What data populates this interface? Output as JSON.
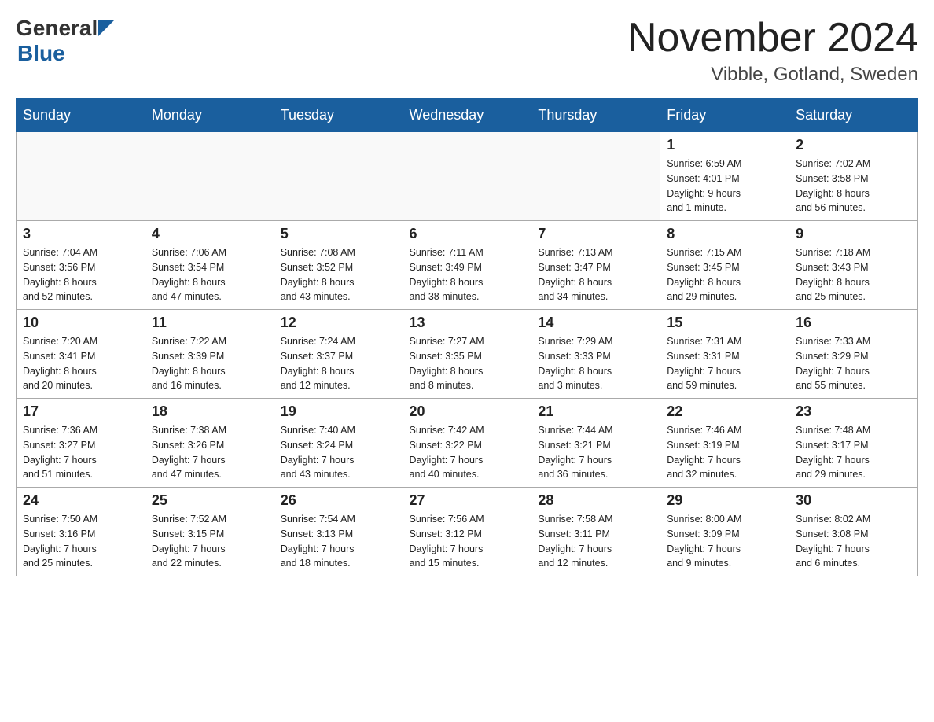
{
  "header": {
    "logo_general": "General",
    "logo_blue": "Blue",
    "month_year": "November 2024",
    "location": "Vibble, Gotland, Sweden"
  },
  "days_of_week": [
    "Sunday",
    "Monday",
    "Tuesday",
    "Wednesday",
    "Thursday",
    "Friday",
    "Saturday"
  ],
  "weeks": [
    [
      {
        "day": "",
        "info": ""
      },
      {
        "day": "",
        "info": ""
      },
      {
        "day": "",
        "info": ""
      },
      {
        "day": "",
        "info": ""
      },
      {
        "day": "",
        "info": ""
      },
      {
        "day": "1",
        "info": "Sunrise: 6:59 AM\nSunset: 4:01 PM\nDaylight: 9 hours\nand 1 minute."
      },
      {
        "day": "2",
        "info": "Sunrise: 7:02 AM\nSunset: 3:58 PM\nDaylight: 8 hours\nand 56 minutes."
      }
    ],
    [
      {
        "day": "3",
        "info": "Sunrise: 7:04 AM\nSunset: 3:56 PM\nDaylight: 8 hours\nand 52 minutes."
      },
      {
        "day": "4",
        "info": "Sunrise: 7:06 AM\nSunset: 3:54 PM\nDaylight: 8 hours\nand 47 minutes."
      },
      {
        "day": "5",
        "info": "Sunrise: 7:08 AM\nSunset: 3:52 PM\nDaylight: 8 hours\nand 43 minutes."
      },
      {
        "day": "6",
        "info": "Sunrise: 7:11 AM\nSunset: 3:49 PM\nDaylight: 8 hours\nand 38 minutes."
      },
      {
        "day": "7",
        "info": "Sunrise: 7:13 AM\nSunset: 3:47 PM\nDaylight: 8 hours\nand 34 minutes."
      },
      {
        "day": "8",
        "info": "Sunrise: 7:15 AM\nSunset: 3:45 PM\nDaylight: 8 hours\nand 29 minutes."
      },
      {
        "day": "9",
        "info": "Sunrise: 7:18 AM\nSunset: 3:43 PM\nDaylight: 8 hours\nand 25 minutes."
      }
    ],
    [
      {
        "day": "10",
        "info": "Sunrise: 7:20 AM\nSunset: 3:41 PM\nDaylight: 8 hours\nand 20 minutes."
      },
      {
        "day": "11",
        "info": "Sunrise: 7:22 AM\nSunset: 3:39 PM\nDaylight: 8 hours\nand 16 minutes."
      },
      {
        "day": "12",
        "info": "Sunrise: 7:24 AM\nSunset: 3:37 PM\nDaylight: 8 hours\nand 12 minutes."
      },
      {
        "day": "13",
        "info": "Sunrise: 7:27 AM\nSunset: 3:35 PM\nDaylight: 8 hours\nand 8 minutes."
      },
      {
        "day": "14",
        "info": "Sunrise: 7:29 AM\nSunset: 3:33 PM\nDaylight: 8 hours\nand 3 minutes."
      },
      {
        "day": "15",
        "info": "Sunrise: 7:31 AM\nSunset: 3:31 PM\nDaylight: 7 hours\nand 59 minutes."
      },
      {
        "day": "16",
        "info": "Sunrise: 7:33 AM\nSunset: 3:29 PM\nDaylight: 7 hours\nand 55 minutes."
      }
    ],
    [
      {
        "day": "17",
        "info": "Sunrise: 7:36 AM\nSunset: 3:27 PM\nDaylight: 7 hours\nand 51 minutes."
      },
      {
        "day": "18",
        "info": "Sunrise: 7:38 AM\nSunset: 3:26 PM\nDaylight: 7 hours\nand 47 minutes."
      },
      {
        "day": "19",
        "info": "Sunrise: 7:40 AM\nSunset: 3:24 PM\nDaylight: 7 hours\nand 43 minutes."
      },
      {
        "day": "20",
        "info": "Sunrise: 7:42 AM\nSunset: 3:22 PM\nDaylight: 7 hours\nand 40 minutes."
      },
      {
        "day": "21",
        "info": "Sunrise: 7:44 AM\nSunset: 3:21 PM\nDaylight: 7 hours\nand 36 minutes."
      },
      {
        "day": "22",
        "info": "Sunrise: 7:46 AM\nSunset: 3:19 PM\nDaylight: 7 hours\nand 32 minutes."
      },
      {
        "day": "23",
        "info": "Sunrise: 7:48 AM\nSunset: 3:17 PM\nDaylight: 7 hours\nand 29 minutes."
      }
    ],
    [
      {
        "day": "24",
        "info": "Sunrise: 7:50 AM\nSunset: 3:16 PM\nDaylight: 7 hours\nand 25 minutes."
      },
      {
        "day": "25",
        "info": "Sunrise: 7:52 AM\nSunset: 3:15 PM\nDaylight: 7 hours\nand 22 minutes."
      },
      {
        "day": "26",
        "info": "Sunrise: 7:54 AM\nSunset: 3:13 PM\nDaylight: 7 hours\nand 18 minutes."
      },
      {
        "day": "27",
        "info": "Sunrise: 7:56 AM\nSunset: 3:12 PM\nDaylight: 7 hours\nand 15 minutes."
      },
      {
        "day": "28",
        "info": "Sunrise: 7:58 AM\nSunset: 3:11 PM\nDaylight: 7 hours\nand 12 minutes."
      },
      {
        "day": "29",
        "info": "Sunrise: 8:00 AM\nSunset: 3:09 PM\nDaylight: 7 hours\nand 9 minutes."
      },
      {
        "day": "30",
        "info": "Sunrise: 8:02 AM\nSunset: 3:08 PM\nDaylight: 7 hours\nand 6 minutes."
      }
    ]
  ]
}
